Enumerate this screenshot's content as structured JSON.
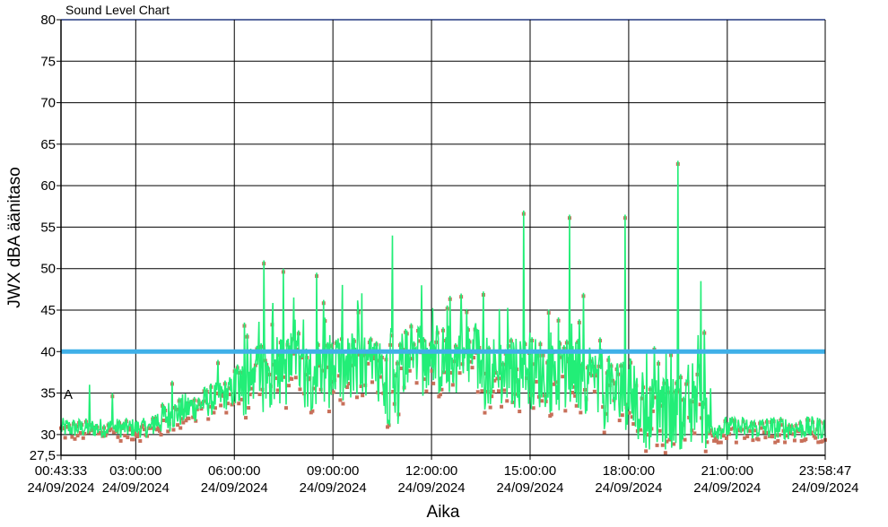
{
  "chart_data": {
    "type": "line",
    "title": "Sound Level Chart",
    "xlabel": "Aika",
    "ylabel": "JWX dBA äänitaso",
    "ylim": [
      27.5,
      80
    ],
    "y_ticks": [
      27.5,
      30,
      35,
      40,
      45,
      50,
      55,
      60,
      65,
      70,
      75,
      80
    ],
    "y_tick_labels": [
      "27,5",
      "30",
      "35",
      "40",
      "45",
      "50",
      "55",
      "60",
      "65",
      "70",
      "75",
      "80"
    ],
    "x_range_hours": [
      0.7258,
      23.9797
    ],
    "x_ticks": [
      {
        "hour": 0.7258,
        "time": "00:43:33",
        "date": "24/09/2024"
      },
      {
        "hour": 3,
        "time": "03:00:00",
        "date": "24/09/2024"
      },
      {
        "hour": 6,
        "time": "06:00:00",
        "date": "24/09/2024"
      },
      {
        "hour": 9,
        "time": "09:00:00",
        "date": "24/09/2024"
      },
      {
        "hour": 12,
        "time": "12:00:00",
        "date": "24/09/2024"
      },
      {
        "hour": 15,
        "time": "15:00:00",
        "date": "24/09/2024"
      },
      {
        "hour": 18,
        "time": "18:00:00",
        "date": "24/09/2024"
      },
      {
        "hour": 21,
        "time": "21:00:00",
        "date": "24/09/2024"
      },
      {
        "hour": 23.9797,
        "time": "23:58:47",
        "date": "24/09/2024"
      }
    ],
    "threshold": 40,
    "annotation": "A",
    "grid": true,
    "series": [
      {
        "color": "#22ee77",
        "marker_color": "#c8705a",
        "peaks": [
          {
            "hour": 1.6,
            "value": 36
          },
          {
            "hour": 2.3,
            "value": 35
          },
          {
            "hour": 4.1,
            "value": 36.5
          },
          {
            "hour": 5.5,
            "value": 39
          },
          {
            "hour": 6.3,
            "value": 43.5
          },
          {
            "hour": 6.9,
            "value": 51
          },
          {
            "hour": 7.5,
            "value": 50
          },
          {
            "hour": 8.5,
            "value": 49.5
          },
          {
            "hour": 10.8,
            "value": 54
          },
          {
            "hour": 11.7,
            "value": 48
          },
          {
            "hour": 12.9,
            "value": 47
          },
          {
            "hour": 14.8,
            "value": 57
          },
          {
            "hour": 16.2,
            "value": 56.5
          },
          {
            "hour": 17.9,
            "value": 56.5
          },
          {
            "hour": 19.5,
            "value": 63
          },
          {
            "hour": 20.2,
            "value": 48.5
          }
        ]
      }
    ]
  }
}
